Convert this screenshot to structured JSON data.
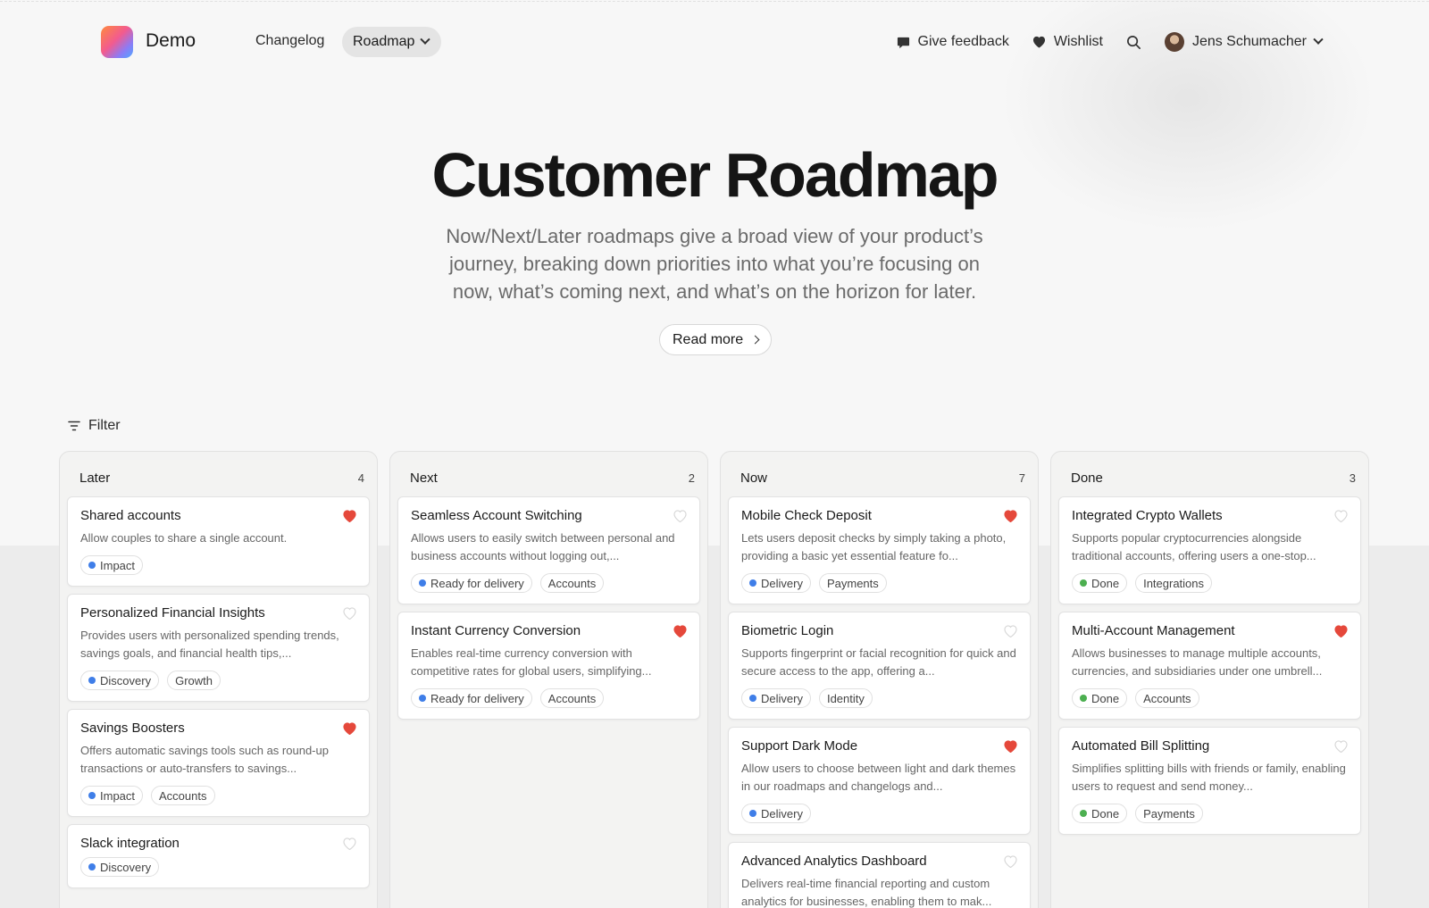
{
  "brand": {
    "name": "Demo"
  },
  "nav": {
    "changelog": "Changelog",
    "roadmap": "Roadmap"
  },
  "header_right": {
    "feedback": "Give feedback",
    "wishlist": "Wishlist",
    "user": "Jens Schumacher"
  },
  "hero": {
    "title": "Customer Roadmap",
    "subtitle": "Now/Next/Later roadmaps give a broad view of your product’s journey, breaking down priorities into what you’re focusing on now, what’s coming next, and what’s on the horizon for later.",
    "read_more": "Read more"
  },
  "filter": {
    "label": "Filter"
  },
  "colors": {
    "blue_dot": "#3f7ee8",
    "green_dot": "#4caf50",
    "heart_red": "#e5483b",
    "heart_empty": "#d6d6d6"
  },
  "columns": [
    {
      "title": "Later",
      "count": "4",
      "cards": [
        {
          "title": "Shared accounts",
          "desc": "Allow couples to share a single account.",
          "liked": true,
          "tags": [
            {
              "label": "Impact",
              "dot": "blue"
            }
          ]
        },
        {
          "title": "Personalized Financial Insights",
          "desc": "Provides users with personalized spending trends, savings goals, and financial health tips,...",
          "liked": false,
          "tags": [
            {
              "label": "Discovery",
              "dot": "blue"
            },
            {
              "label": "Growth",
              "dot": ""
            }
          ]
        },
        {
          "title": "Savings Boosters",
          "desc": "Offers automatic savings tools such as round-up transactions or auto-transfers to savings...",
          "liked": true,
          "tags": [
            {
              "label": "Impact",
              "dot": "blue"
            },
            {
              "label": "Accounts",
              "dot": ""
            }
          ]
        },
        {
          "title": "Slack integration",
          "desc": "",
          "liked": false,
          "tags": [
            {
              "label": "Discovery",
              "dot": "blue"
            }
          ]
        }
      ]
    },
    {
      "title": "Next",
      "count": "2",
      "cards": [
        {
          "title": "Seamless Account Switching",
          "desc": "Allows users to easily switch between personal and business accounts without logging out,...",
          "liked": false,
          "tags": [
            {
              "label": "Ready for delivery",
              "dot": "blue"
            },
            {
              "label": "Accounts",
              "dot": ""
            }
          ]
        },
        {
          "title": "Instant Currency Conversion",
          "desc": "Enables real-time currency conversion with competitive rates for global users, simplifying...",
          "liked": true,
          "tags": [
            {
              "label": "Ready for delivery",
              "dot": "blue"
            },
            {
              "label": "Accounts",
              "dot": ""
            }
          ]
        }
      ]
    },
    {
      "title": "Now",
      "count": "7",
      "cards": [
        {
          "title": "Mobile Check Deposit",
          "desc": "Lets users deposit checks by simply taking a photo, providing a basic yet essential feature fo...",
          "liked": true,
          "tags": [
            {
              "label": "Delivery",
              "dot": "blue"
            },
            {
              "label": "Payments",
              "dot": ""
            }
          ]
        },
        {
          "title": "Biometric Login",
          "desc": "Supports fingerprint or facial recognition for quick and secure access to the app, offering a...",
          "liked": false,
          "tags": [
            {
              "label": "Delivery",
              "dot": "blue"
            },
            {
              "label": "Identity",
              "dot": ""
            }
          ]
        },
        {
          "title": "Support Dark Mode",
          "desc": "Allow users to choose between light and dark themes in our roadmaps and changelogs and...",
          "liked": true,
          "tags": [
            {
              "label": "Delivery",
              "dot": "blue"
            }
          ]
        },
        {
          "title": "Advanced Analytics Dashboard",
          "desc": "Delivers real-time financial reporting and custom analytics for businesses, enabling them to mak...",
          "liked": false,
          "tags": []
        }
      ]
    },
    {
      "title": "Done",
      "count": "3",
      "cards": [
        {
          "title": "Integrated Crypto Wallets",
          "desc": "Supports popular cryptocurrencies alongside traditional accounts, offering users a one-stop...",
          "liked": false,
          "tags": [
            {
              "label": "Done",
              "dot": "green"
            },
            {
              "label": "Integrations",
              "dot": ""
            }
          ]
        },
        {
          "title": "Multi-Account Management",
          "desc": "Allows businesses to manage multiple accounts, currencies, and subsidiaries under one umbrell...",
          "liked": true,
          "tags": [
            {
              "label": "Done",
              "dot": "green"
            },
            {
              "label": "Accounts",
              "dot": ""
            }
          ]
        },
        {
          "title": "Automated Bill Splitting",
          "desc": "Simplifies splitting bills with friends or family, enabling users to request and send money...",
          "liked": false,
          "tags": [
            {
              "label": "Done",
              "dot": "green"
            },
            {
              "label": "Payments",
              "dot": ""
            }
          ]
        }
      ]
    }
  ]
}
